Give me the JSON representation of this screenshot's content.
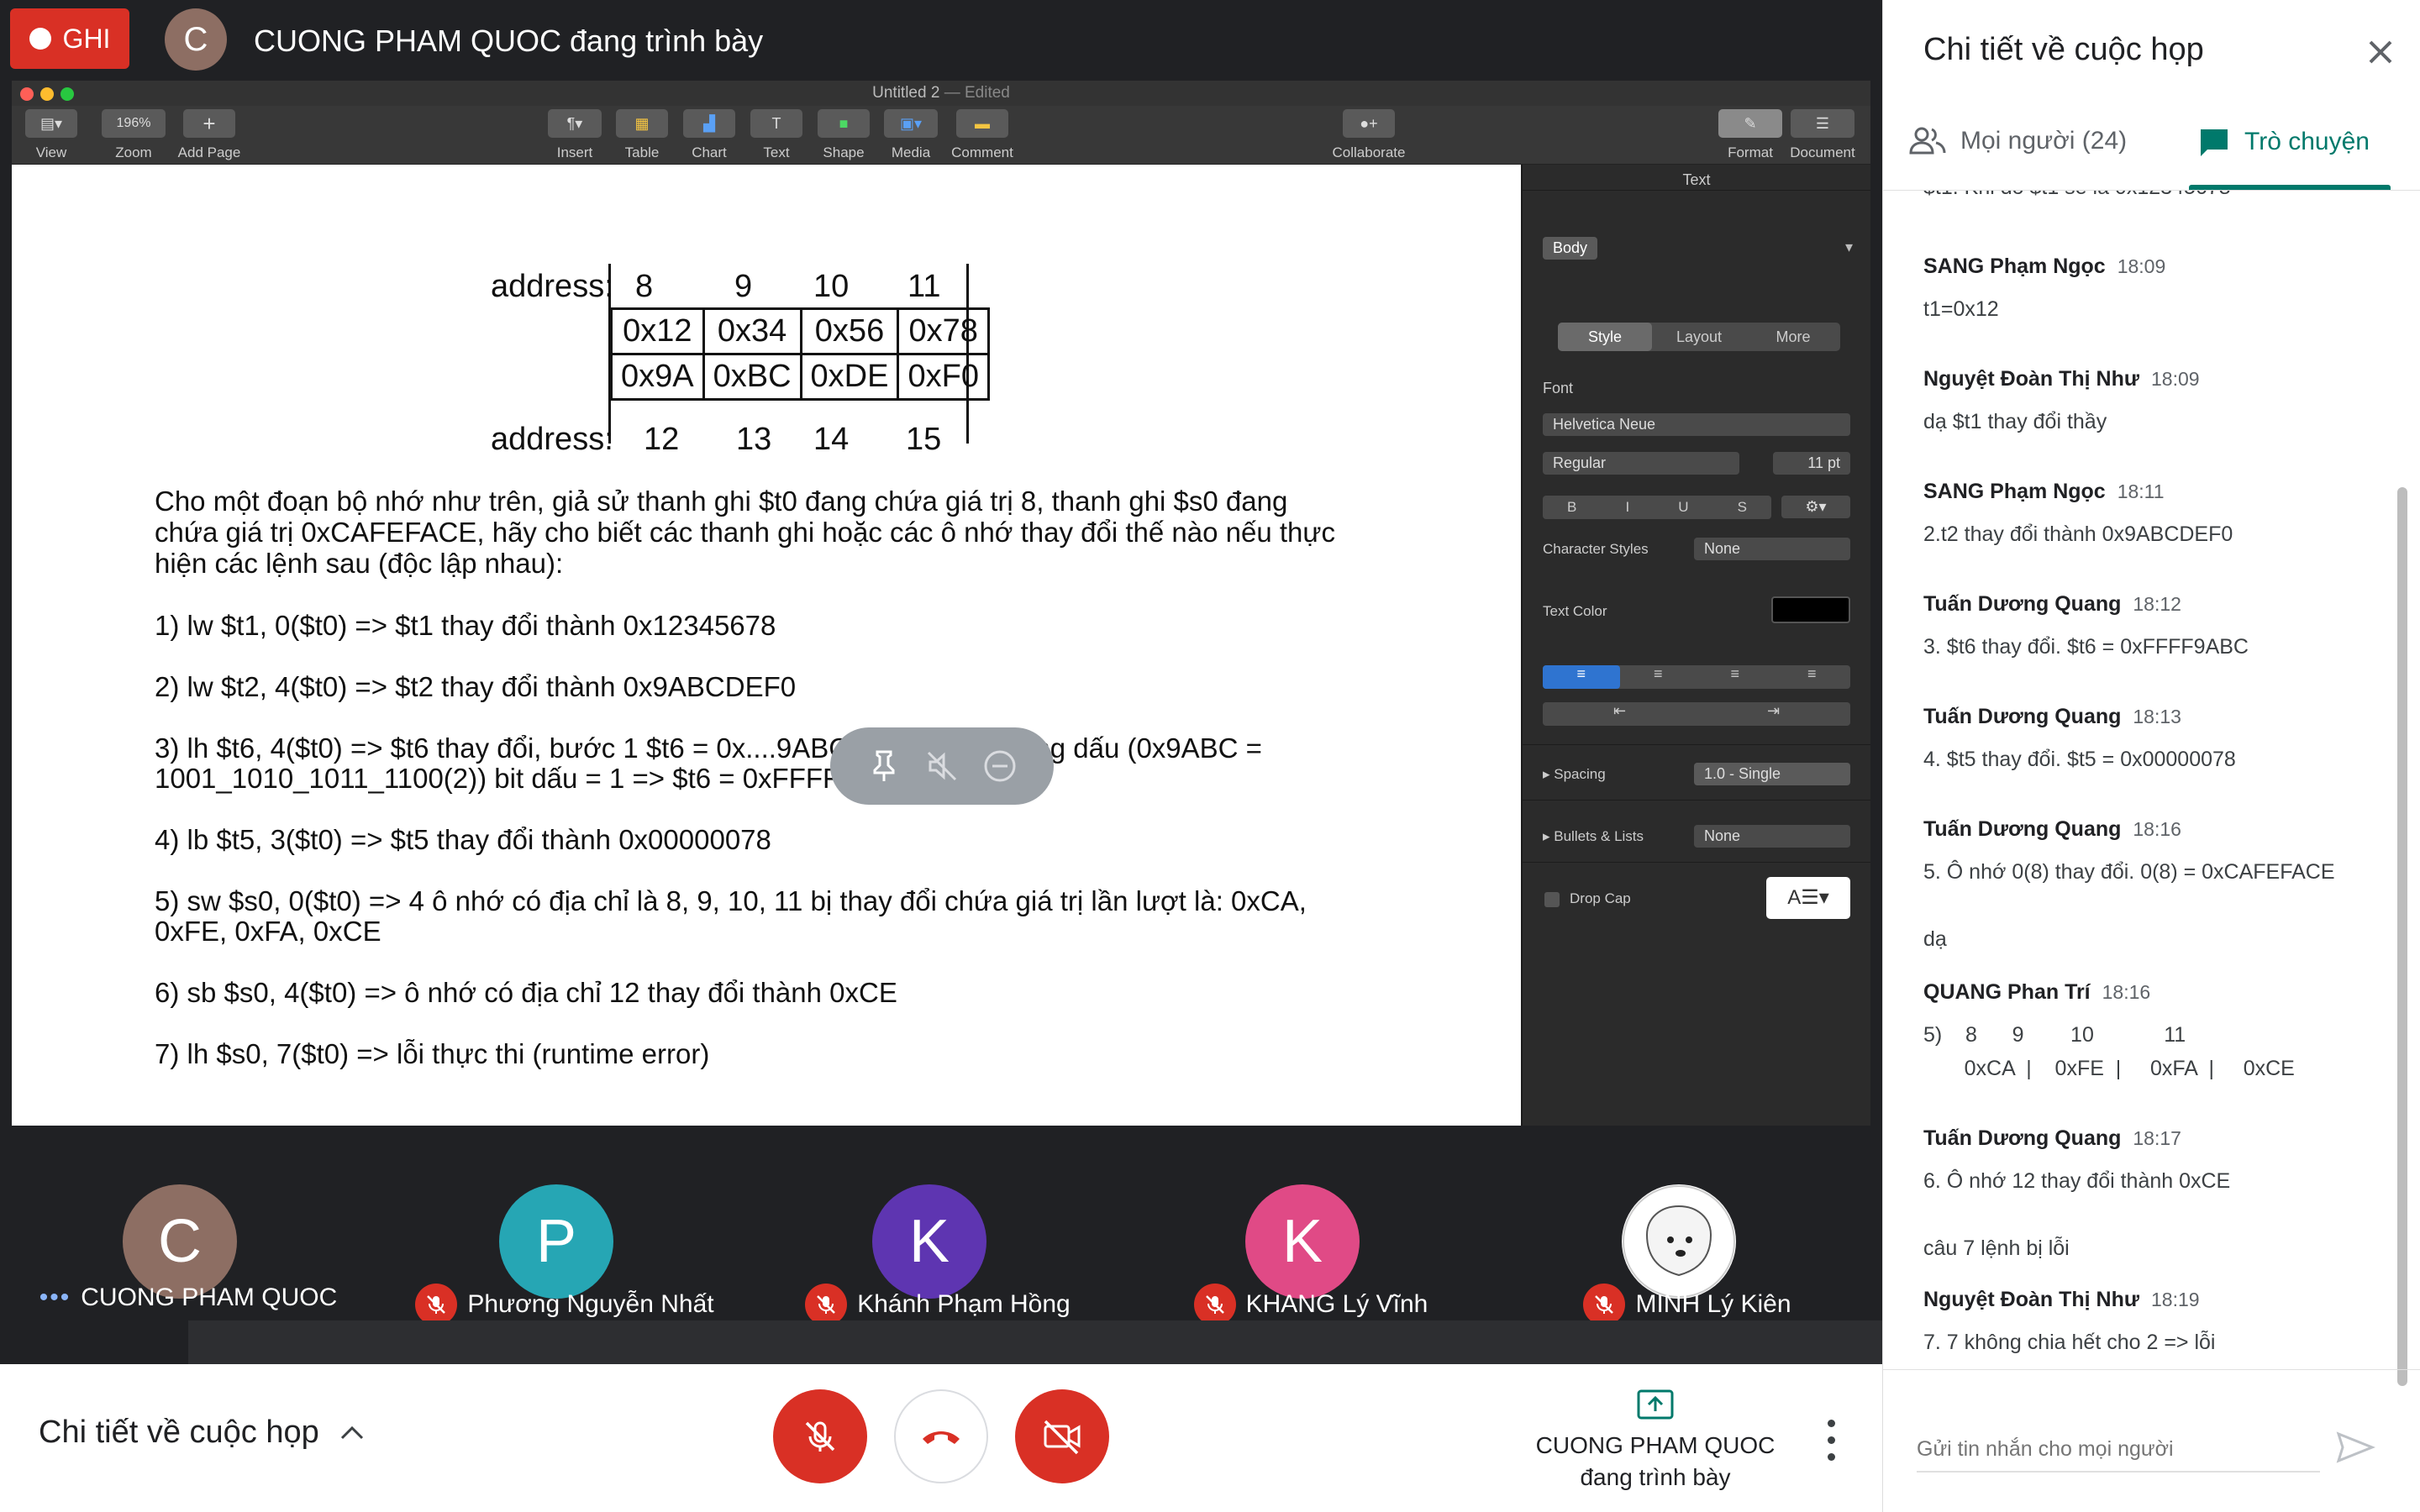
{
  "topbar": {
    "record_label": "GHI",
    "presenter_initial": "C",
    "presenter_text": "CUONG PHAM QUOC đang trình bày"
  },
  "mac": {
    "window_title": "Untitled 2",
    "window_status": "— Edited",
    "toolbar": {
      "view": "View",
      "zoom": "Zoom",
      "zoom_value": "196%",
      "add_page": "Add Page",
      "insert": "Insert",
      "table": "Table",
      "chart": "Chart",
      "text": "Text",
      "shape": "Shape",
      "media": "Media",
      "comment": "Comment",
      "collaborate": "Collaborate",
      "format": "Format",
      "document": "Document"
    },
    "inspector": {
      "header": "Text",
      "paragraph_style": "Body",
      "tabs": [
        "Style",
        "Layout",
        "More"
      ],
      "font_label": "Font",
      "font_name": "Helvetica Neue",
      "font_weight": "Regular",
      "font_size": "11 pt",
      "format_buttons": [
        "B",
        "I",
        "U",
        "S"
      ],
      "char_styles_label": "Character Styles",
      "char_styles_value": "None",
      "text_color_label": "Text Color",
      "spacing_label": "Spacing",
      "spacing_value": "1.0 - Single",
      "bullets_label": "Bullets & Lists",
      "bullets_value": "None",
      "dropcap_label": "Drop Cap"
    }
  },
  "doc": {
    "address_label_top": "address:",
    "address_label_bottom": "address:",
    "top_addresses": [
      "8",
      "9",
      "10",
      "11"
    ],
    "bottom_addresses": [
      "12",
      "13",
      "14",
      "15"
    ],
    "row1": [
      "0x12",
      "0x34",
      "0x56",
      "0x78"
    ],
    "row2": [
      "0x9A",
      "0xBC",
      "0xDE",
      "0xF0"
    ],
    "intro": [
      "Cho một đoạn bộ nhớ như trên, giả sử thanh ghi $t0 đang chứa giá trị 8, thanh ghi $s0 đang",
      "chứa giá trị 0xCAFEFACE, hãy cho biết các thanh ghi hoặc các ô nhớ thay đổi thế nào nếu thực",
      "hiện các lệnh sau (độc lập nhau):"
    ],
    "items": [
      [
        "1)   lw $t1, 0($t0) => $t1 thay đổi thành 0x12345678"
      ],
      [
        "2) lw $t2, 4($t0) => $t2 thay đổi thành 0x9ABCDEF0"
      ],
      [
        "3) lh $t6, 4($t0) => $t6 thay đổi, bước 1 $t6 = 0x....9ABC, bước 2 mở rộng dấu (0x9ABC =",
        "1001_1010_1011_1100(2)) bit dấu = 1 => $t6 = 0xFFFF9ABC"
      ],
      [
        "4) lb $t5, 3($t0) => $t5 thay đổi thành 0x00000078"
      ],
      [
        "5) sw $s0, 0($t0) => 4 ô nhớ có địa chỉ là 8, 9, 10, 11 bị thay đổi chứa giá trị lần lượt là: 0xCA,",
        "0xFE, 0xFA, 0xCE"
      ],
      [
        "6) sb $s0, 4($t0) => ô nhớ có địa chỉ 12 thay đổi thành 0xCE"
      ],
      [
        "7) lh $s0, 7($t0) => lỗi thực thi (runtime error)"
      ]
    ]
  },
  "participants": [
    {
      "initial": "C",
      "name": "CUONG PHAM QUOC",
      "color": "#8d6e63",
      "muted": false
    },
    {
      "initial": "P",
      "name": "Phương Nguyễn Nhất",
      "color": "#26a6b4",
      "muted": true
    },
    {
      "initial": "K",
      "name": "Khánh Phạm Hồng",
      "color": "#5e35b1",
      "muted": true
    },
    {
      "initial": "K",
      "name": "KHANG Lý Vĩnh",
      "color": "#e04a86",
      "muted": true
    },
    {
      "initial": "",
      "name": "MINH Lý Kiên",
      "color": "#ffffff",
      "muted": true
    }
  ],
  "bottombar": {
    "meeting_details": "Chi tiết về cuộc họp",
    "presenting_name": "CUONG PHAM QUOC",
    "presenting_status": "đang trình bày"
  },
  "panel": {
    "title": "Chi tiết về cuộc họp",
    "tab_people": "Mọi người (24)",
    "tab_chat": "Trò chuyện",
    "messages": [
      {
        "sender": "SANG Phạm Ngọc",
        "time": "18:09",
        "text": "t1=0x12"
      },
      {
        "sender": "Nguyệt Đoàn Thị Như",
        "time": "18:09",
        "text": "dạ $t1 thay đổi thầy"
      },
      {
        "sender": "SANG Phạm Ngọc",
        "time": "18:11",
        "text": "2.t2 thay đổi thành 0x9ABCDEF0"
      },
      {
        "sender": "Tuấn Dương Quang",
        "time": "18:12",
        "text": "3. $t6 thay đổi. $t6 = 0xFFFF9ABC"
      },
      {
        "sender": "Tuấn Dương Quang",
        "time": "18:13",
        "text": "4. $t5 thay đổi. $t5 = 0x00000078"
      },
      {
        "sender": "Tuấn Dương Quang",
        "time": "18:16",
        "text": "5. Ô nhớ 0(8) thay đổi. 0(8) = 0xCAFEFACE\n\ndạ"
      },
      {
        "sender": "QUANG Phan Trí",
        "time": "18:16",
        "text": "5)    8      9        10            11\n       0xCA  |    0xFE  |     0xFA  |     0xCE"
      },
      {
        "sender": "Tuấn Dương Quang",
        "time": "18:17",
        "text": "6. Ô nhớ 12 thay đổi thành 0xCE\n\ncâu 7 lệnh bị lỗi"
      },
      {
        "sender": "Nguyệt Đoàn Thị Như",
        "time": "18:19",
        "text": "7. 7 không chia hết cho 2 => lỗi"
      }
    ],
    "input_placeholder": "Gửi tin nhắn cho mọi người"
  }
}
